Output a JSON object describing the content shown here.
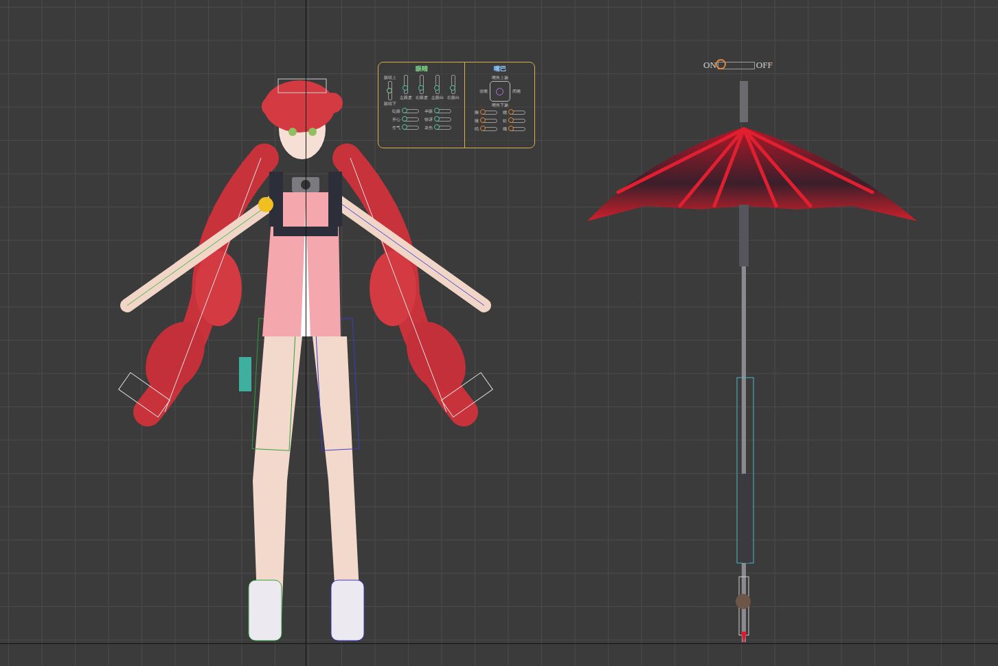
{
  "eye_panel": {
    "title": "眼睛",
    "top_label": "眼睛上",
    "bottom_label": "眼睛下",
    "center_level": 0.5,
    "vertical_sliders": [
      {
        "label": "左眼皮",
        "level": 0.3
      },
      {
        "label": "右眼皮",
        "level": 0.3
      },
      {
        "label": "左眼白",
        "level": 0.3
      },
      {
        "label": "右眼白",
        "level": 0.3
      }
    ],
    "sliders": [
      {
        "label": "眨眼",
        "level": 0.1
      },
      {
        "label": "半眼",
        "level": 0.1
      },
      {
        "label": "开心",
        "level": 0.1
      },
      {
        "label": "惊讶",
        "level": 0.1
      },
      {
        "label": "生气",
        "level": 0.1
      },
      {
        "label": "哀伤",
        "level": 0.1
      }
    ]
  },
  "mouth_panel": {
    "title": "嘴巴",
    "joystick": {
      "top": "嘴角上扬",
      "bottom": "嘴角下扬",
      "left": "张嘴",
      "right": "闭嘴"
    },
    "sliders": [
      {
        "label": "啊",
        "level": 0.1
      },
      {
        "label": "嗯",
        "level": 0.1
      },
      {
        "label": "咦",
        "level": 0.1
      },
      {
        "label": "欸",
        "level": 0.1
      },
      {
        "label": "呜",
        "level": 0.1
      },
      {
        "label": "哦",
        "level": 0.1
      }
    ]
  },
  "switch": {
    "on_label": "ON",
    "off_label": "OFF",
    "on": true
  }
}
